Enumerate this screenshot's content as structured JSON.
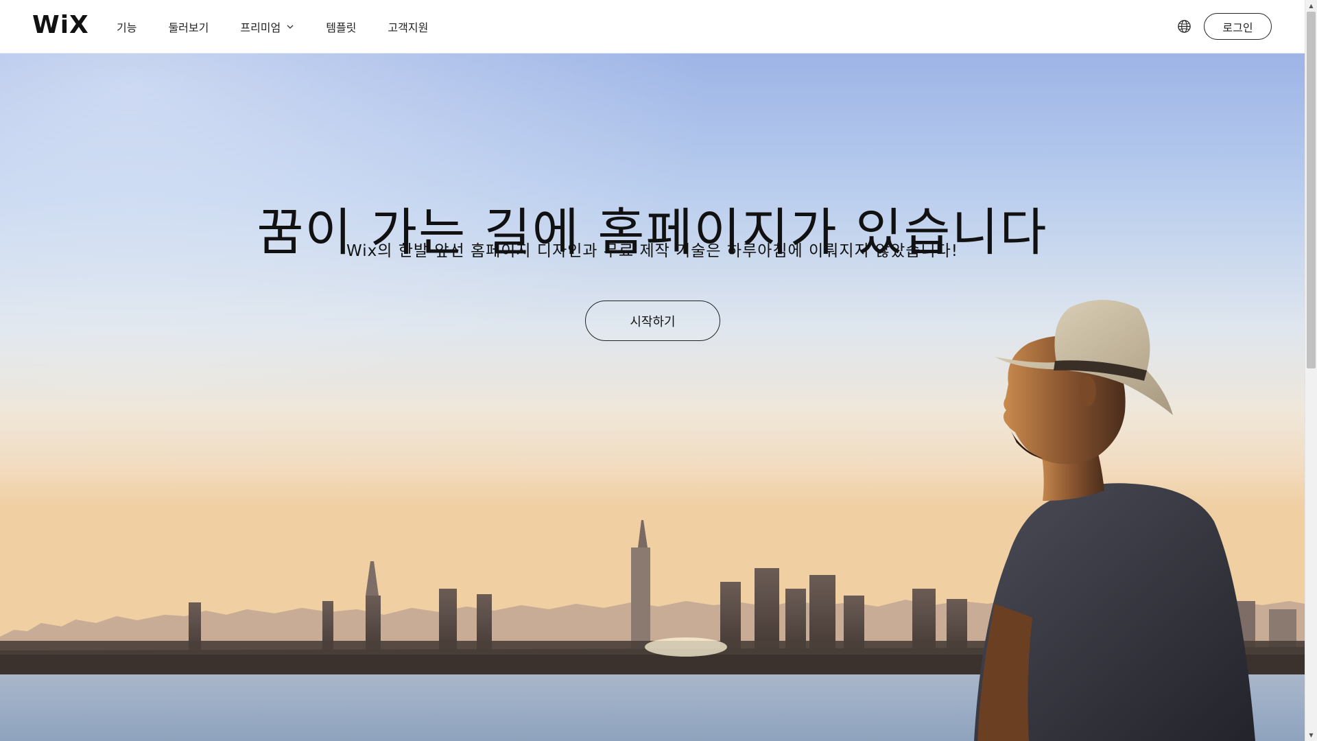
{
  "header": {
    "logo": "WiX",
    "nav": [
      {
        "label": "기능"
      },
      {
        "label": "둘러보기"
      },
      {
        "label": "프리미엄",
        "has_dropdown": true
      },
      {
        "label": "템플릿"
      },
      {
        "label": "고객지원"
      }
    ],
    "globe_icon": "globe-icon",
    "login_label": "로그인"
  },
  "hero": {
    "title": "꿈이 가는 길에 홈페이지가 있습니다",
    "subtitle": "Wix의 한발 앞선 홈페이지 디자인과 무료 제작 기술은 하루아침에 이뤄지지 않았습니다!",
    "cta_label": "시작하기"
  },
  "colors": {
    "text": "#111111",
    "header_bg": "#ffffff",
    "sky_top": "#9db4e6",
    "horizon": "#f0cfa3"
  }
}
